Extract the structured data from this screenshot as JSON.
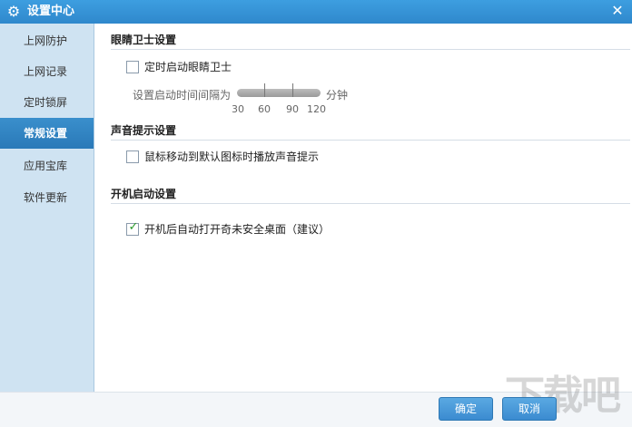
{
  "window": {
    "title": "设置中心",
    "close_glyph": "✕"
  },
  "sidebar": {
    "items": [
      {
        "label": "上网防护",
        "active": false
      },
      {
        "label": "上网记录",
        "active": false
      },
      {
        "label": "定时锁屏",
        "active": false
      },
      {
        "label": "常规设置",
        "active": true
      },
      {
        "label": "应用宝库",
        "active": false
      },
      {
        "label": "软件更新",
        "active": false
      }
    ]
  },
  "main": {
    "eye_guard": {
      "title": "眼睛卫士设置",
      "timer_checkbox": {
        "label": "定时启动眼睛卫士",
        "checked": false
      },
      "interval": {
        "label": "设置启动时间间隔为",
        "unit": "分钟",
        "ticks": [
          "30",
          "60",
          "90",
          "120"
        ]
      }
    },
    "sound": {
      "title": "声音提示设置",
      "hover_checkbox": {
        "label": "鼠标移动到默认图标时播放声音提示",
        "checked": false
      }
    },
    "startup": {
      "title": "开机启动设置",
      "desktop_checkbox": {
        "label": "开机后自动打开奇未安全桌面（建议）",
        "checked": true
      }
    }
  },
  "footer": {
    "ok_label": "确定",
    "cancel_label": "取消"
  },
  "watermark": "下载吧",
  "colors": {
    "titlebar": "#3394d8",
    "sidebar_bg": "#cfe3f2",
    "active_item": "#2f82c2",
    "button": "#4a9ad9",
    "check": "#2a9a2a"
  }
}
